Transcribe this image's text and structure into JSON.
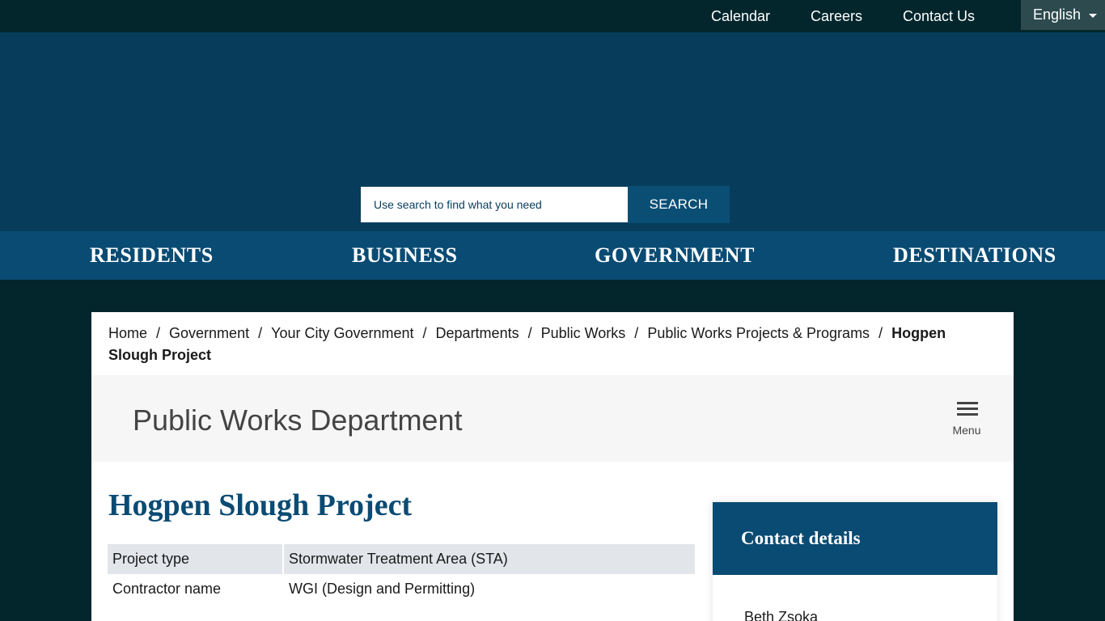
{
  "topbar": {
    "links": [
      "Calendar",
      "Careers",
      "Contact Us"
    ],
    "language": "English"
  },
  "search": {
    "placeholder": "Use search to find what you need",
    "button": "SEARCH"
  },
  "nav": [
    "RESIDENTS",
    "BUSINESS",
    "GOVERNMENT",
    "DESTINATIONS"
  ],
  "breadcrumb": {
    "items": [
      "Home",
      "Government",
      "Your City Government",
      "Departments",
      "Public Works",
      "Public Works Projects & Programs"
    ],
    "current": "Hogpen Slough Project"
  },
  "department": {
    "title": "Public Works Department",
    "menu_label": "Menu"
  },
  "page": {
    "title": "Hogpen Slough Project"
  },
  "project_table": [
    {
      "label": "Project type",
      "value": "Stormwater Treatment Area (STA)"
    },
    {
      "label": "Contractor name",
      "value": "WGI (Design and Permitting)"
    }
  ],
  "contact": {
    "title": "Contact details",
    "name": "Beth Zsoka"
  },
  "colors": {
    "topbar_bg": "#02262c",
    "hero_bg": "#073d5b",
    "nav_bg": "#0a4b73",
    "accent": "#0a4b73",
    "table_shade": "#e2e5ea"
  }
}
